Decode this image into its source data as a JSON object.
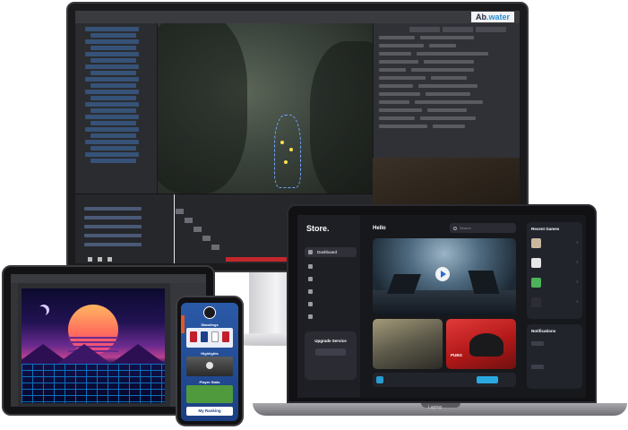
{
  "editor": {
    "title": "",
    "menus": [],
    "brand_a": "Ab",
    "brand_b": ".water"
  },
  "store": {
    "logo": "Store.",
    "nav": [
      {
        "label": "Dashboard",
        "active": true
      },
      {
        "label": "",
        "active": false
      },
      {
        "label": "",
        "active": false
      },
      {
        "label": "",
        "active": false
      },
      {
        "label": "",
        "active": false
      },
      {
        "label": "",
        "active": false
      }
    ],
    "upgrade": {
      "title": "Upgrade Service",
      "text": "",
      "button": ""
    },
    "greeting": "Hello",
    "search_placeholder": "Search",
    "cards": [
      {
        "title": "",
        "sub": ""
      },
      {
        "title": "PUBG",
        "sub": ""
      }
    ],
    "banner": {
      "text": "",
      "button": ""
    },
    "recent_games": {
      "title": "Recent Games",
      "items": [
        {
          "name": "",
          "meta": "",
          "color": "#c9b8a0"
        },
        {
          "name": "",
          "meta": "",
          "color": "#e6e6e6"
        },
        {
          "name": "",
          "meta": "",
          "color": "#4db35a"
        },
        {
          "name": "",
          "meta": "",
          "color": "#2d2d35"
        }
      ]
    },
    "notifications": {
      "title": "Notifications",
      "items": [
        {
          "title": ""
        },
        {
          "title": ""
        }
      ]
    },
    "laptop_label": "Laptop"
  },
  "phone": {
    "standings": "Standings",
    "highlights": "Highlights",
    "player_stats": "Player Stats",
    "ranking_button": "My Ranking"
  }
}
